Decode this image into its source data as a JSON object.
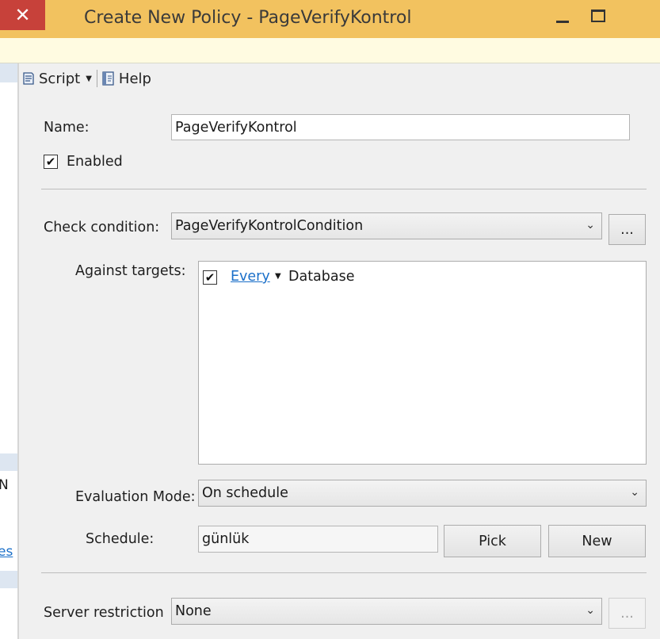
{
  "window": {
    "title": "Create New Policy - PageVerifyKontrol",
    "close_glyph": "✕"
  },
  "left_pane": {
    "fragment_1": "N",
    "fragment_2": "es"
  },
  "toolbar": {
    "script_label": "Script",
    "help_label": "Help"
  },
  "form": {
    "name_label": "Name:",
    "name_value": "PageVerifyKontrol",
    "enabled_label": "Enabled",
    "enabled_checked": true,
    "check_condition_label": "Check condition:",
    "check_condition_value": "PageVerifyKontrolCondition",
    "browse_label": "...",
    "against_targets_label": "Against targets:",
    "target": {
      "checked": true,
      "quantifier": "Every",
      "object": "Database"
    },
    "evaluation_mode_label": "Evaluation Mode:",
    "evaluation_mode_value": "On schedule",
    "schedule_label": "Schedule:",
    "schedule_value": "günlük",
    "pick_label": "Pick",
    "new_label": "New",
    "server_restriction_label": "Server restriction",
    "server_restriction_value": "None",
    "server_browse_label": "..."
  },
  "icons": {
    "check": "✔",
    "chevron": "⌄",
    "caret": "▼"
  },
  "colors": {
    "titlebar": "#f2c25f",
    "infobar": "#fffbe1",
    "close": "#c7413a",
    "link": "#1a6fc9"
  }
}
